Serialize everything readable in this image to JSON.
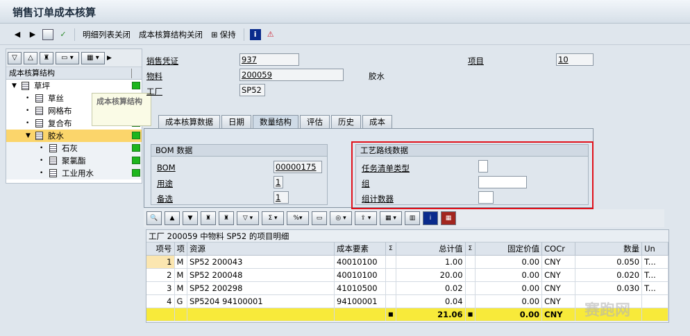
{
  "window": {
    "title": "销售订单成本核算"
  },
  "toolbar": {
    "detail_list_close": "明细列表关闭",
    "cost_structure_close": "成本核算结构关闭",
    "save": "保持"
  },
  "tree": {
    "header": "成本核算结构",
    "tooltip": "成本核算结构",
    "items": [
      {
        "label": "草坪"
      },
      {
        "label": "草丝"
      },
      {
        "label": "网格布"
      },
      {
        "label": "复合布"
      },
      {
        "label": "胶水"
      },
      {
        "label": "石灰"
      },
      {
        "label": "聚氯酯"
      },
      {
        "label": "工业用水"
      }
    ]
  },
  "header": {
    "sales_doc_label": "销售凭证",
    "sales_doc_value": "937",
    "item_label": "项目",
    "item_value": "10",
    "material_label": "物料",
    "material_value": "200059",
    "material_desc": "胶水",
    "plant_label": "工厂",
    "plant_value": "SP52"
  },
  "tabs": [
    "成本核算数据",
    "日期",
    "数量结构",
    "评估",
    "历史",
    "成本"
  ],
  "bom_group": {
    "title": "BOM 数据",
    "bom_label": "BOM",
    "bom_value": "00000175",
    "usage_label": "用途",
    "usage_value": "1",
    "alt_label": "备选",
    "alt_value": "1"
  },
  "routing_group": {
    "title": "工艺路线数据",
    "task_list_type_label": "任务清单类型",
    "group_label": "组",
    "group_counter_label": "组计数器"
  },
  "grid": {
    "title": "工厂 200059 中物料 SP52 的项目明细",
    "columns": [
      "项号",
      "项",
      "资源",
      "成本要素",
      "Σ",
      "总计值",
      "Σ",
      "固定价值",
      "COCr",
      "数量",
      "Un"
    ],
    "rows": [
      {
        "no": "1",
        "cat": "M",
        "resource": "SP52 200043",
        "cost_elem": "40010100",
        "total": "1.00",
        "fixed": "0.00",
        "cur": "CNY",
        "qty": "0.050",
        "un": "T..."
      },
      {
        "no": "2",
        "cat": "M",
        "resource": "SP52 200048",
        "cost_elem": "40010100",
        "total": "20.00",
        "fixed": "0.00",
        "cur": "CNY",
        "qty": "0.020",
        "un": "T..."
      },
      {
        "no": "3",
        "cat": "M",
        "resource": "SP52 200298",
        "cost_elem": "41010500",
        "total": "0.02",
        "fixed": "0.00",
        "cur": "CNY",
        "qty": "0.030",
        "un": "T..."
      },
      {
        "no": "4",
        "cat": "G",
        "resource": "SP5204 94100001",
        "cost_elem": "94100001",
        "total": "0.04",
        "fixed": "0.00",
        "cur": "CNY",
        "qty": "",
        "un": ""
      }
    ],
    "sum": {
      "total": "21.06",
      "fixed": "0.00",
      "cur": "CNY"
    }
  },
  "watermark": {
    "text": "赛跑网"
  },
  "colors": {
    "status_green": "#1db61d",
    "selection": "#fbd56b",
    "sum_row": "#f8ea3a",
    "highlight_box": "#e0101a"
  }
}
